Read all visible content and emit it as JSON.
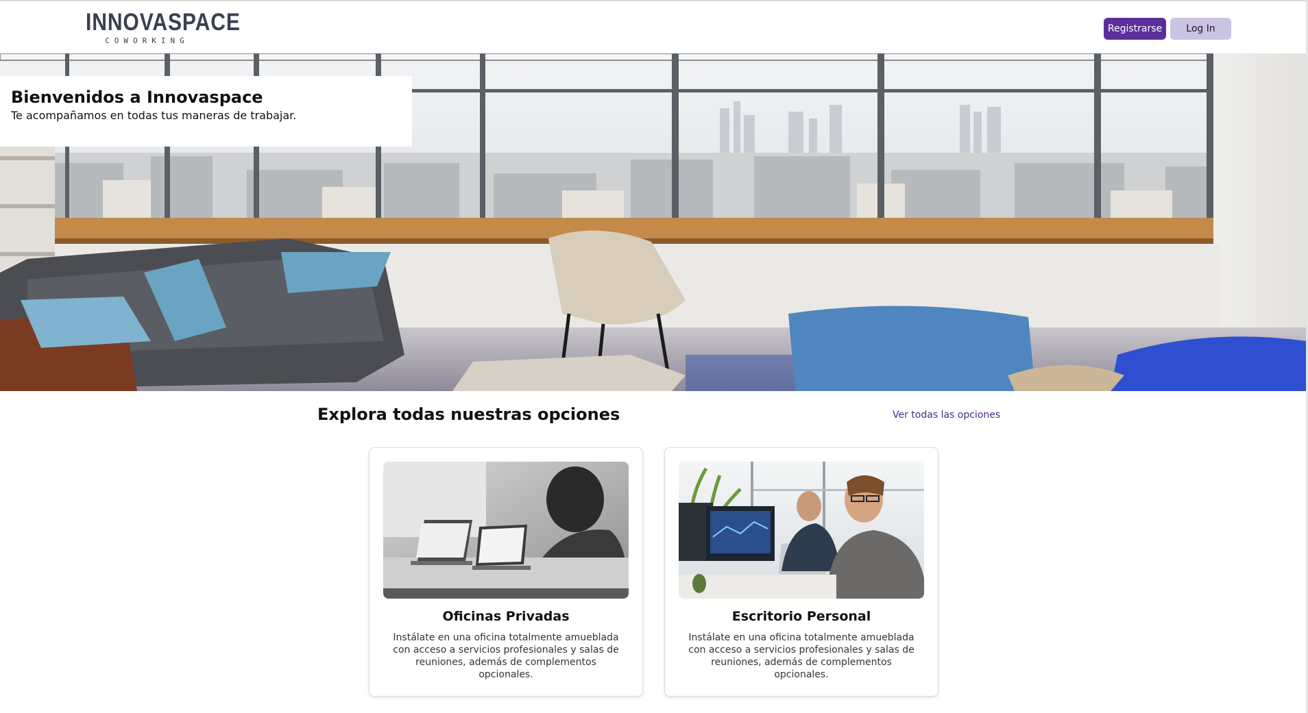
{
  "brand": {
    "name": "INNOVASPACE",
    "tagline": "COWORKING"
  },
  "header": {
    "register_label": "Registrarse",
    "login_label": "Log In"
  },
  "hero": {
    "title": "Bienvenidos a Innovaspace",
    "subtitle": "Te acompañamos en todas tus maneras de trabajar."
  },
  "options": {
    "title": "Explora todas nuestras opciones",
    "see_all_label": "Ver todas las opciones",
    "cards": [
      {
        "title": "Oficinas Privadas",
        "description": "Instálate en una oficina totalmente amueblada con acceso a servicios profesionales y salas de reuniones, además de complementos opcionales."
      },
      {
        "title": "Escritorio Personal",
        "description": "Instálate en una oficina totalmente amueblada con acceso a servicios profesionales y salas de reuniones, además de complementos opcionales."
      }
    ]
  },
  "colors": {
    "primary": "#5a2f9a",
    "secondary": "#cbc3e3",
    "link": "#4a2a8a",
    "logo": "#3b3f4f"
  }
}
